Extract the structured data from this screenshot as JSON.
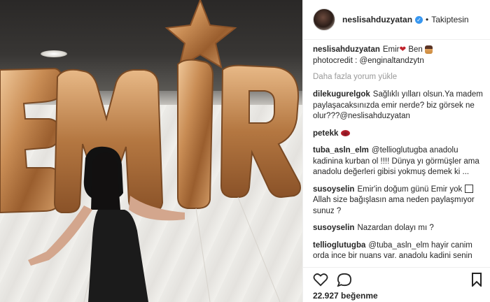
{
  "post": {
    "username": "neslisahduzyatan",
    "follow_status": "Takiptesin",
    "caption_text": "Emir",
    "caption_suffix": "Ben",
    "photocredit": "photocredit : @enginaltandzytn",
    "load_more": "Daha fazla yorum yükle",
    "likes": "22.927 beğenme",
    "balloon_text": "EMIR"
  },
  "comments": [
    {
      "user": "dilekugurelgok",
      "text": "Sağlıklı yılları olsun.Ya madem paylaşacaksınızda emir nerde? biz görsek ne olur???@neslisahduzyatan"
    },
    {
      "user": "petekk",
      "text": ""
    },
    {
      "user": "tuba_asln_elm",
      "text": "@tellioglutugba anadolu kadinina kurban ol !!!! Dünya yı görmüşler ama anadolu değerleri gibisi yokmuş demek ki ..."
    },
    {
      "user": "susoyselin",
      "text": "Emir'in doğum günü Emir yok",
      "text2": "Allah size bağışlasın ama neden paylaşmıyor sunuz ?"
    },
    {
      "user": "susoyselin",
      "text": "Nazardan dolayı mı ?"
    },
    {
      "user": "tellioglutugba",
      "text": "@tuba_asln_elm hayir canim orda ince bir nuans var. anadolu kadini senin benim babaannelerimiz degil artik"
    }
  ],
  "icons": [
    "heart-icon",
    "comment-icon",
    "bookmark-icon",
    "verified-badge-icon"
  ],
  "colors": {
    "link": "#003569",
    "verified": "#3897f0",
    "muted": "#999999",
    "balloon": "#c08a5a"
  }
}
